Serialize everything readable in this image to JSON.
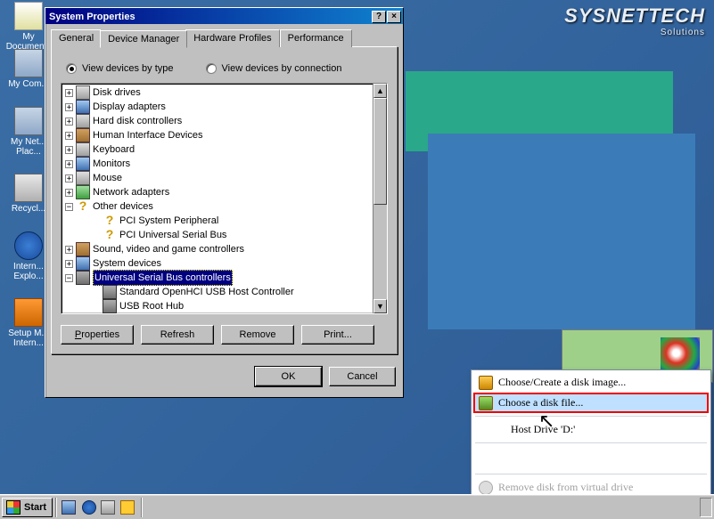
{
  "watermark": {
    "main": "SYSNETTECH",
    "sub": "Solutions"
  },
  "desktop": {
    "docs": "My Documents",
    "computer": "My Com...",
    "network": "My Net...\nPlac...",
    "recycle": "Recycl...",
    "ie": "Intern...\nExplo...",
    "setup": "Setup M...\nIntern..."
  },
  "dialog": {
    "title": "System Properties",
    "tabs": {
      "general": "General",
      "device": "Device Manager",
      "hardware": "Hardware Profiles",
      "perf": "Performance"
    },
    "radio_type": "View devices by type",
    "radio_conn": "View devices by connection",
    "tree": {
      "disk": "Disk drives",
      "display": "Display adapters",
      "hdd": "Hard disk controllers",
      "hid": "Human Interface Devices",
      "kb": "Keyboard",
      "mon": "Monitors",
      "mouse": "Mouse",
      "net": "Network adapters",
      "other": "Other devices",
      "other1": "PCI System Peripheral",
      "other2": "PCI Universal Serial Bus",
      "sound": "Sound, video and game controllers",
      "sysdev": "System devices",
      "usb": "Universal Serial Bus controllers",
      "usb1": "Standard OpenHCI USB Host Controller",
      "usb2": "USB Root Hub"
    },
    "btn_props": "Properties",
    "btn_refresh": "Refresh",
    "btn_remove": "Remove",
    "btn_print": "Print...",
    "btn_ok": "OK",
    "btn_cancel": "Cancel"
  },
  "ctx": {
    "create": "Choose/Create a disk image...",
    "file": "Choose a disk file...",
    "host": "Host Drive 'D:'",
    "remove": "Remove disk from virtual drive"
  },
  "taskbar": {
    "start": "Start"
  }
}
